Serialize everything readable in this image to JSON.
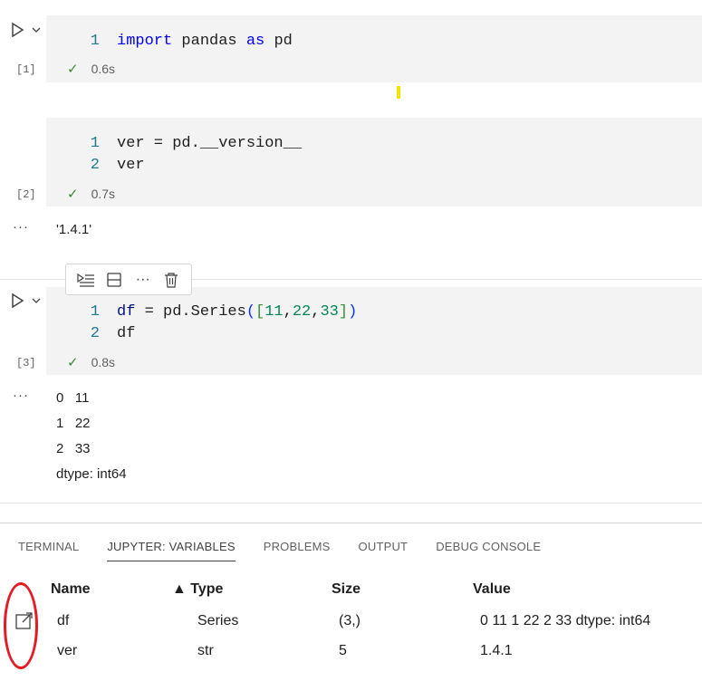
{
  "cells": [
    {
      "exec_count": "[1]",
      "lines": [
        {
          "ln": "1",
          "kw1": "import",
          "mid": " pandas ",
          "kw2": "as",
          "end": " pd"
        }
      ],
      "status_time": "0.6s"
    },
    {
      "exec_count": "[2]",
      "lines": [
        {
          "ln": "1",
          "text": "ver = pd.__version__"
        },
        {
          "ln": "2",
          "text": "ver"
        }
      ],
      "status_time": "0.7s",
      "output": "'1.4.1'"
    },
    {
      "exec_count": "[3]",
      "lines": [
        {
          "ln": "1",
          "pre": "df = pd.Series(",
          "b1": "(",
          "b2": "[",
          "n1": "11",
          "c1": ",",
          "n2": "22",
          "c2": ",",
          "n3": "33",
          "b3": "]",
          "b4": ")"
        },
        {
          "ln": "2",
          "text": "df"
        }
      ],
      "status_time": "0.8s",
      "output_lines": [
        "0   11",
        "1   22",
        "2   33",
        "dtype: int64"
      ]
    }
  ],
  "output_dots": "···",
  "panel": {
    "tabs": [
      "TERMINAL",
      "JUPYTER: VARIABLES",
      "PROBLEMS",
      "OUTPUT",
      "DEBUG CONSOLE"
    ],
    "active_tab": "JUPYTER: VARIABLES",
    "columns": {
      "name": "Name",
      "type": "▲ Type",
      "size": "Size",
      "value": "Value"
    },
    "rows": [
      {
        "name": "df",
        "type": "Series",
        "size": "(3,)",
        "value": "0 11 1 22 2 33 dtype: int64"
      },
      {
        "name": "ver",
        "type": "str",
        "size": "5",
        "value": "1.4.1"
      }
    ]
  },
  "annotation_color": "#e31b23"
}
